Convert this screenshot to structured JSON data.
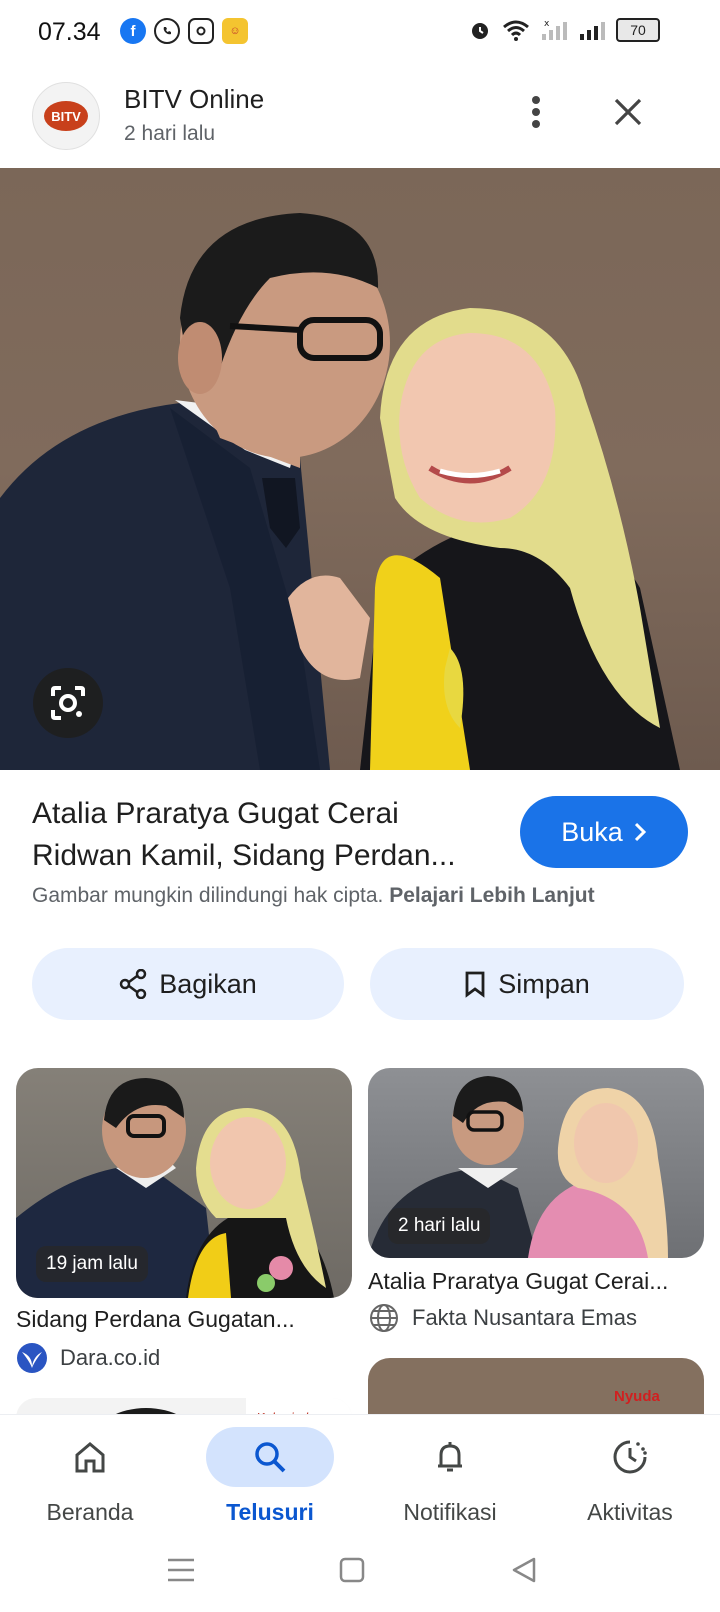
{
  "status_bar": {
    "time": "07.34",
    "battery": "70",
    "apps": [
      "facebook-icon",
      "whatsapp-icon",
      "instagram-icon",
      "game-app-icon"
    ]
  },
  "header": {
    "publisher": "BITV Online",
    "age": "2 hari lalu",
    "logo_text": "BITV"
  },
  "article": {
    "title_line1": "Atalia Praratya Gugat Cerai",
    "title_line2": "Ridwan Kamil, Sidang Perdan...",
    "open_label": "Buka",
    "copyright_text": "Gambar mungkin dilindungi hak cipta.",
    "learn_more": "Pelajari Lebih Lanjut",
    "share_label": "Bagikan",
    "save_label": "Simpan"
  },
  "related": [
    {
      "time": "19 jam lalu",
      "title": "Sidang Perdana Gugatan...",
      "source": "Dara.co.id"
    },
    {
      "time": "2 hari lalu",
      "title": "Atalia Praratya Gugat Cerai...",
      "source": "Fakta Nusantara Emas"
    },
    {
      "watermark": "Kabarindo.com"
    },
    {
      "watermark": "Nyuda"
    }
  ],
  "bottom_nav": [
    {
      "label": "Beranda",
      "icon": "home-icon"
    },
    {
      "label": "Telusuri",
      "icon": "search-icon",
      "active": true
    },
    {
      "label": "Notifikasi",
      "icon": "bell-icon"
    },
    {
      "label": "Aktivitas",
      "icon": "activity-icon"
    }
  ],
  "colors": {
    "accent": "#1a73e8",
    "pill_bg": "#e8f0fe",
    "nav_active": "#0b57d0"
  }
}
